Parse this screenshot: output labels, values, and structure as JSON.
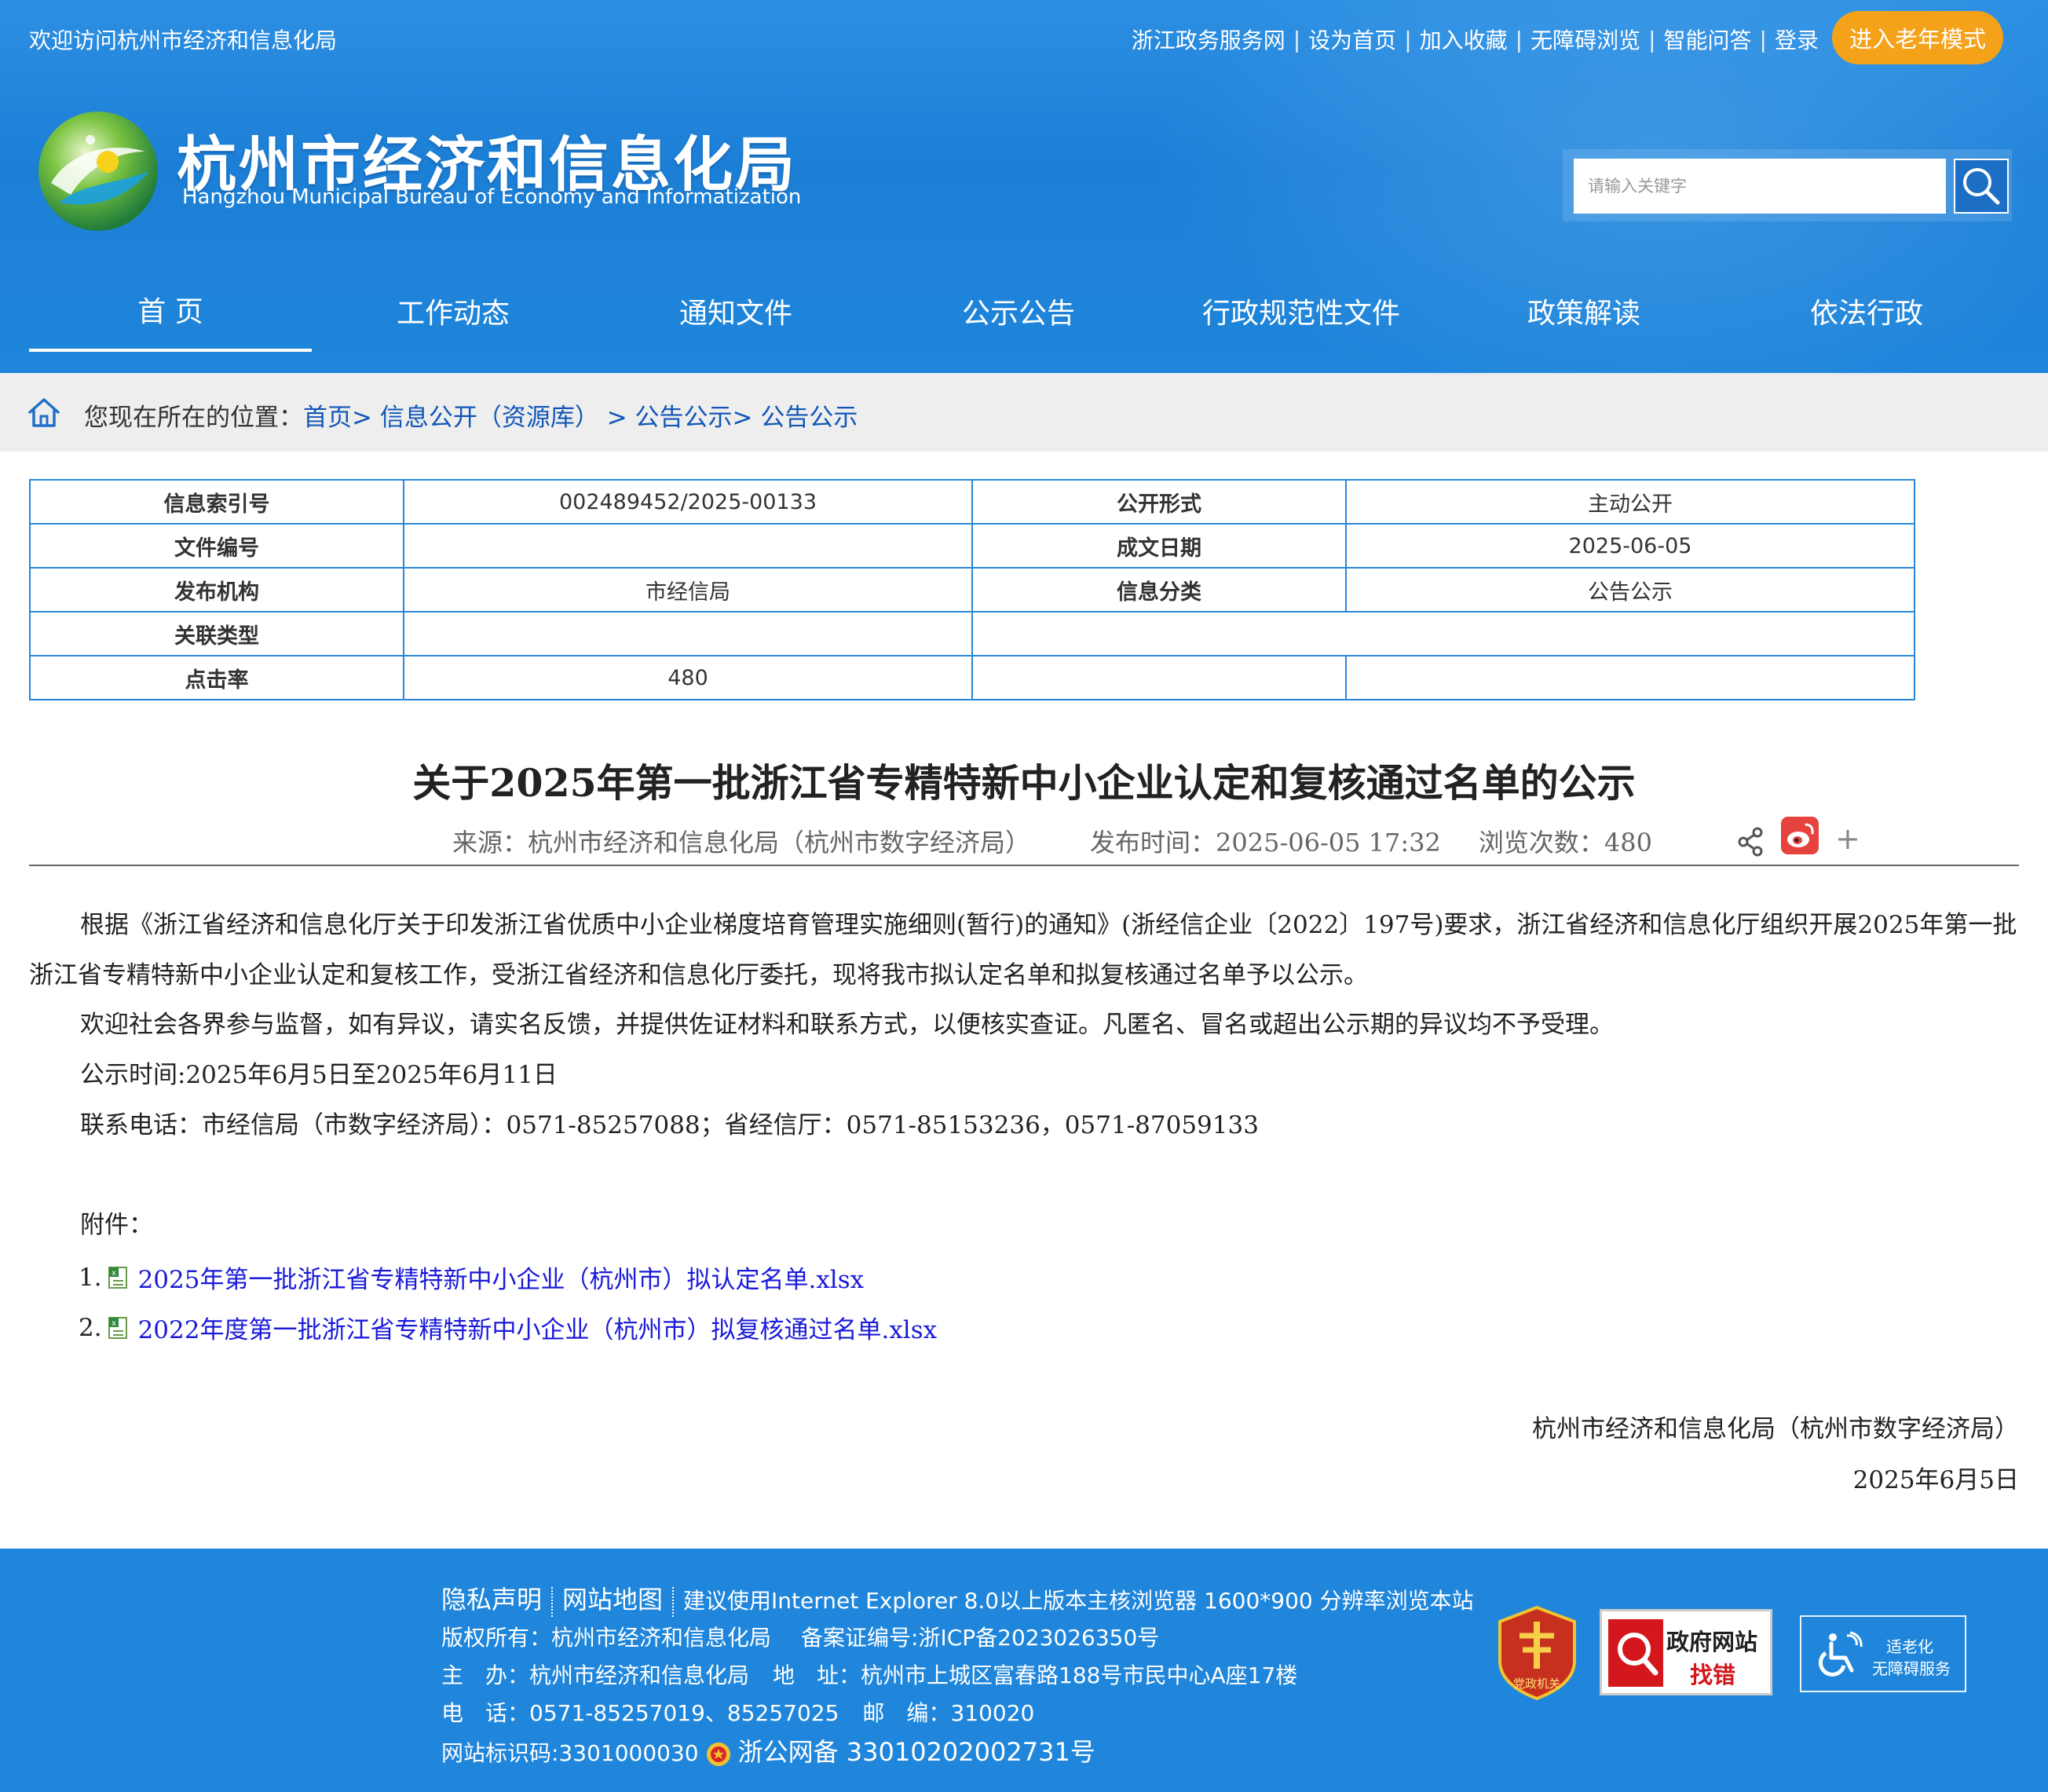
{
  "header": {
    "welcome": "欢迎访问杭州市经济和信息化局",
    "top_links": [
      "浙江政务服务网",
      "设为首页",
      "加入收藏",
      "无障碍浏览",
      "智能问答",
      "登录"
    ],
    "elder_mode": "进入老年模式",
    "logo_cn": "杭州市经济和信息化局",
    "logo_en": "Hangzhou Municipal Bureau of Economy and Informatization",
    "search_placeholder": "请输入关键字"
  },
  "nav": [
    {
      "label": "首 页",
      "active": true
    },
    {
      "label": "工作动态"
    },
    {
      "label": "通知文件"
    },
    {
      "label": "公示公告"
    },
    {
      "label": "行政规范性文件"
    },
    {
      "label": "政策解读"
    },
    {
      "label": "依法行政"
    }
  ],
  "breadcrumb": {
    "label": "您现在所在的位置：",
    "items": [
      "首页",
      "> ",
      "信息公开（资源库）",
      " > ",
      "公告公示",
      "> ",
      "公告公示"
    ]
  },
  "info_table": {
    "index_no_k": "信息索引号",
    "index_no_v": "002489452/2025-00133",
    "open_form_k": "公开形式",
    "open_form_v": "主动公开",
    "doc_no_k": "文件编号",
    "doc_no_v": "",
    "date_k": "成文日期",
    "date_v": "2025-06-05",
    "org_k": "发布机构",
    "org_v": "市经信局",
    "category_k": "信息分类",
    "category_v": "公告公示",
    "rel_type_k": "关联类型",
    "rel_type_v": "",
    "clicks_k": "点击率",
    "clicks_v": "480"
  },
  "article": {
    "title": "关于2025年第一批浙江省专精特新中小企业认定和复核通过名单的公示",
    "source": "来源：杭州市经济和信息化局（杭州市数字经济局）",
    "published": "发布时间：2025-06-05 17:32",
    "views": "浏览次数：480",
    "p1": "根据《浙江省经济和信息化厅关于印发浙江省优质中小企业梯度培育管理实施细则(暂行)的通知》(浙经信企业〔2022〕197号)要求，浙江省经济和信息化厅组织开展2025年第一批浙江省专精特新中小企业认定和复核工作，受浙江省经济和信息化厅委托，现将我市拟认定名单和拟复核通过名单予以公示。",
    "p2": "欢迎社会各界参与监督，如有异议，请实名反馈，并提供佐证材料和联系方式，以便核实查证。凡匿名、冒名或超出公示期的异议均不予受理。",
    "p3": "公示时间:2025年6月5日至2025年6月11日",
    "p4": "联系电话：市经信局（市数字经济局）：0571-85257088；省经信厅：0571-85153236，0571-87059133",
    "attach_label": "附件：",
    "attachments": [
      {
        "num": "1.",
        "name": "2025年第一批浙江省专精特新中小企业（杭州市）拟认定名单.xlsx"
      },
      {
        "num": "2.",
        "name": "2022年度第一批浙江省专精特新中小企业（杭州市）拟复核通过名单.xlsx"
      }
    ],
    "signature_org": "杭州市经济和信息化局（杭州市数字经济局）",
    "signature_date": "2025年6月5日"
  },
  "footer": {
    "privacy": "隐私声明",
    "sitemap": "网站地图",
    "browser_note": "建议使用Internet Explorer 8.0以上版本主核浏览器 1600*900 分辨率浏览本站",
    "copyright": "版权所有：杭州市经济和信息化局",
    "icp": "备案证编号:浙ICP备2023026350号",
    "host_label": "主　办：",
    "host_value": "杭州市经济和信息化局",
    "addr_label": "地　址：",
    "addr_value": "杭州市上城区富春路188号市民中心A座17楼",
    "phone_label": "电　话：",
    "phone_value": "0571-85257019、85257025",
    "zip_label": "邮　编：",
    "zip_value": "310020",
    "site_id": "网站标识码:3301000030",
    "police_record": "浙公网备 33010202002731号",
    "badge_party": "党政机关",
    "badge_correct_1": "政府网站",
    "badge_correct_2": "找错",
    "badge_access_1": "适老化",
    "badge_access_2": "无障碍服务"
  },
  "colors": {
    "header_blue": "#1f86db",
    "elder_orange": "#f5a21b",
    "link_blue": "#1156b8",
    "attachment_link": "#1a1ad9",
    "table_border": "#2a86d8"
  }
}
